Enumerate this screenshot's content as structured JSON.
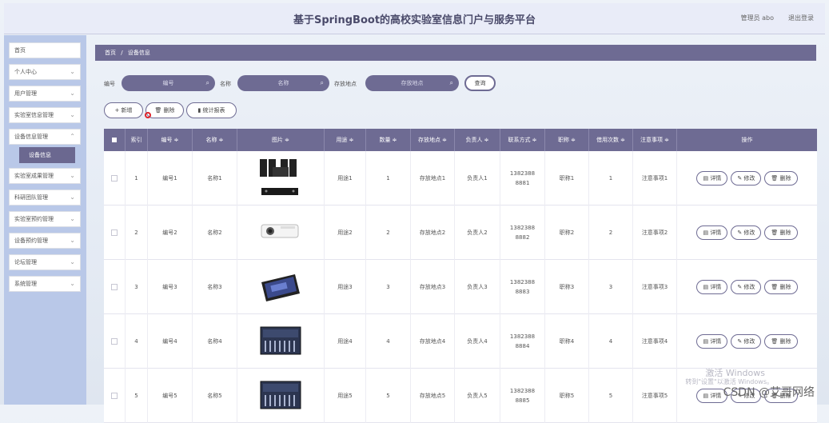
{
  "header": {
    "title": "基于SpringBoot的高校实验室信息门户与服务平台",
    "user": "管理员 abo",
    "logout": "退出登录"
  },
  "sidebar": {
    "items": [
      {
        "label": "首页"
      },
      {
        "label": "个人中心"
      },
      {
        "label": "用户管理"
      },
      {
        "label": "实验室信息管理"
      },
      {
        "label": "设备信息管理"
      },
      {
        "label": "实验室成果管理"
      },
      {
        "label": "科研团队管理"
      },
      {
        "label": "实验室预约管理"
      },
      {
        "label": "设备预约管理"
      },
      {
        "label": "论坛管理"
      },
      {
        "label": "系统管理"
      }
    ],
    "sub_active": "设备信息"
  },
  "breadcrumb": {
    "home": "首页",
    "sep": "/",
    "current": "设备信息"
  },
  "search": {
    "no_label": "编号",
    "no_placeholder": "编号",
    "name_label": "名称",
    "name_placeholder": "名称",
    "loc_label": "存放地点",
    "loc_placeholder": "存放地点",
    "query": "查询"
  },
  "toolbar": {
    "add": "+ 新增",
    "delete": "删除",
    "report": "统计报表"
  },
  "table": {
    "columns": [
      "索引",
      "编号 ≑",
      "名称 ≑",
      "图片 ≑",
      "用途 ≑",
      "数量 ≑",
      "存放地点 ≑",
      "负责人 ≑",
      "联系方式 ≑",
      "职称 ≑",
      "借用次数 ≑",
      "注意事项 ≑",
      "操作"
    ],
    "rows": [
      {
        "idx": "1",
        "no": "编号1",
        "name": "名称1",
        "img": "speaker-set",
        "use": "用途1",
        "qty": "1",
        "loc": "存放地点1",
        "owner": "负责人1",
        "phone": "13823888881",
        "title": "职称1",
        "borrow": "1",
        "note": "注意事项1"
      },
      {
        "idx": "2",
        "no": "编号2",
        "name": "名称2",
        "img": "projector",
        "use": "用途2",
        "qty": "2",
        "loc": "存放地点2",
        "owner": "负责人2",
        "phone": "13823888882",
        "title": "职称2",
        "borrow": "2",
        "note": "注意事项2"
      },
      {
        "idx": "3",
        "no": "编号3",
        "name": "名称3",
        "img": "tablet-device",
        "use": "用途3",
        "qty": "3",
        "loc": "存放地点3",
        "owner": "负责人3",
        "phone": "13823888883",
        "title": "职称3",
        "borrow": "3",
        "note": "注意事项3"
      },
      {
        "idx": "4",
        "no": "编号4",
        "name": "名称4",
        "img": "mixer-console",
        "use": "用途4",
        "qty": "4",
        "loc": "存放地点4",
        "owner": "负责人4",
        "phone": "13823888884",
        "title": "职称4",
        "borrow": "4",
        "note": "注意事项4"
      },
      {
        "idx": "5",
        "no": "编号5",
        "name": "名称5",
        "img": "mixer-console",
        "use": "用途5",
        "qty": "5",
        "loc": "存放地点5",
        "owner": "负责人5",
        "phone": "13823888885",
        "title": "职称5",
        "borrow": "5",
        "note": "注意事项5"
      }
    ],
    "actions": {
      "detail": "详情",
      "edit": "修改",
      "del": "删除"
    }
  },
  "overlay": {
    "activate": "激活 Windows",
    "activate_sub": "转到\"设置\"以激活 Windows。",
    "csdn": "CSDN @艾哥网络"
  },
  "colors": {
    "accent": "#6e6b93",
    "sidebar_bg": "#b9c8e8"
  }
}
